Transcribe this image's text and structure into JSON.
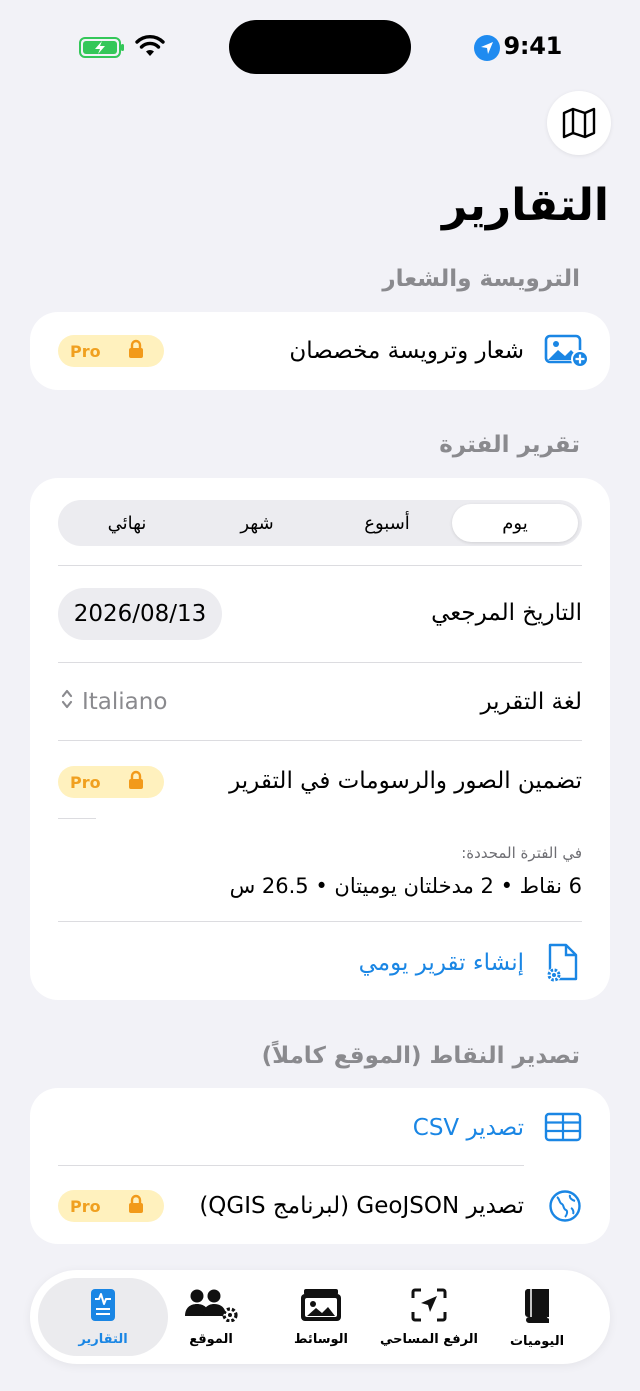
{
  "status_bar": {
    "time": "9:41"
  },
  "page": {
    "title": "التقارير"
  },
  "letterhead_section": {
    "header": "الترويسة والشعار",
    "row_label": "شعار وترويسة مخصصان",
    "badge": "Pro"
  },
  "period_section": {
    "header": "تقرير الفترة",
    "segments": [
      "يوم",
      "أسبوع",
      "شهر",
      "نهائي"
    ],
    "selected_segment": "يوم",
    "reference_date_label": "التاريخ المرجعي",
    "reference_date_value": "2026/08/13",
    "language_label": "لغة التقرير",
    "language_value": "Italiano",
    "include_media_label": "تضمين الصور والرسومات في التقرير",
    "include_media_badge": "Pro",
    "summary_caption": "في الفترة المحددة:",
    "summary_text": "6 نقاط • 2 مدخلتان يوميتان • 26.5 س",
    "create_button": "إنشاء تقرير يومي"
  },
  "export_section": {
    "header": "تصدير النقاط (الموقع كاملاً)",
    "csv_label": "تصدير CSV",
    "geojson_label": "تصدير GeoJSON (لبرنامج QGIS)",
    "geojson_badge": "Pro"
  },
  "tabbar": {
    "items": [
      {
        "label": "التقارير",
        "icon": "reports-icon",
        "active": true
      },
      {
        "label": "الموقع",
        "icon": "site-people-icon",
        "active": false
      },
      {
        "label": "الوسائط",
        "icon": "media-photos-icon",
        "active": false
      },
      {
        "label": "الرفع المساحي",
        "icon": "survey-location-icon",
        "active": false
      },
      {
        "label": "اليوميات",
        "icon": "journal-book-icon",
        "active": false
      }
    ]
  },
  "colors": {
    "accent": "#1a86e4",
    "pro_badge_bg": "#fff1be",
    "pro_text": "#f0a020",
    "background": "#f2f2f7"
  }
}
